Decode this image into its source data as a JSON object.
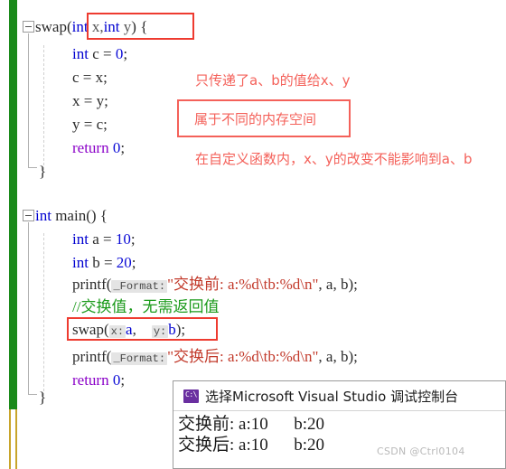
{
  "editor": {
    "change_bar_color": "#1a8a1a",
    "unsaved_bar_color": "#c8a52b",
    "lines": {
      "swap_sig_name": "swap",
      "swap_sig_open": "(",
      "swap_sig_int1": "int",
      "swap_sig_x": " x,",
      "swap_sig_int2": "int",
      "swap_sig_y": " y",
      "swap_sig_close": ")",
      "swap_sig_brace": " {",
      "int_c": "int",
      "int_c_rest": " c = ",
      "int_c_val": "0",
      "int_c_semi": ";",
      "c_eq_x": "c = x;",
      "x_eq_y": "x = y;",
      "y_eq_c": "y = c;",
      "return_kw": "return",
      "return_val": " 0",
      "return_semi": ";",
      "swap_close_brace": "}",
      "main_int": "int",
      "main_name": " main",
      "main_parens": "()",
      "main_brace": " {",
      "int_a": "int",
      "int_a_rest": " a = ",
      "int_a_val": "10",
      "int_a_semi": ";",
      "int_b": "int",
      "int_b_rest": " b = ",
      "int_b_val": "20",
      "int_b_semi": ";",
      "printf1_call": "printf",
      "printf1_open": "(",
      "printf1_hint": "_Format:",
      "printf1_str": "\"交换前: a:%d\\tb:%d\\n\"",
      "printf1_args": ", a, b);",
      "comment": "//交换值，无需返回值",
      "swapcall_name": "swap",
      "swapcall_open": "(",
      "swapcall_hint_x": "x:",
      "swapcall_arg_a": "a",
      "swapcall_comma": ",    ",
      "swapcall_hint_y": "y:",
      "swapcall_arg_b": "b",
      "swapcall_close": ");",
      "printf2_call": "printf",
      "printf2_open": "(",
      "printf2_hint": "_Format:",
      "printf2_str": "\"交换后: a:%d\\tb:%d\\n\"",
      "printf2_args": ", a, b);",
      "main_return_kw": "return",
      "main_return_val": " 0",
      "main_return_semi": ";",
      "main_close_brace": "}"
    }
  },
  "annotations": {
    "color": "#f4615a",
    "note1": "只传递了a、b的值给x、y",
    "note2": "属于不同的内存空间",
    "note3": "在自定义函数内，x、y的改变不能影响到a、b"
  },
  "console": {
    "icon": "cmd-icon",
    "icon_label": "C:\\",
    "title": "选择Microsoft Visual Studio 调试控制台",
    "output": [
      "交换前: a:10      b:20",
      "交换后: a:10      b:20"
    ]
  },
  "watermark": "CSDN @Ctrl0104"
}
